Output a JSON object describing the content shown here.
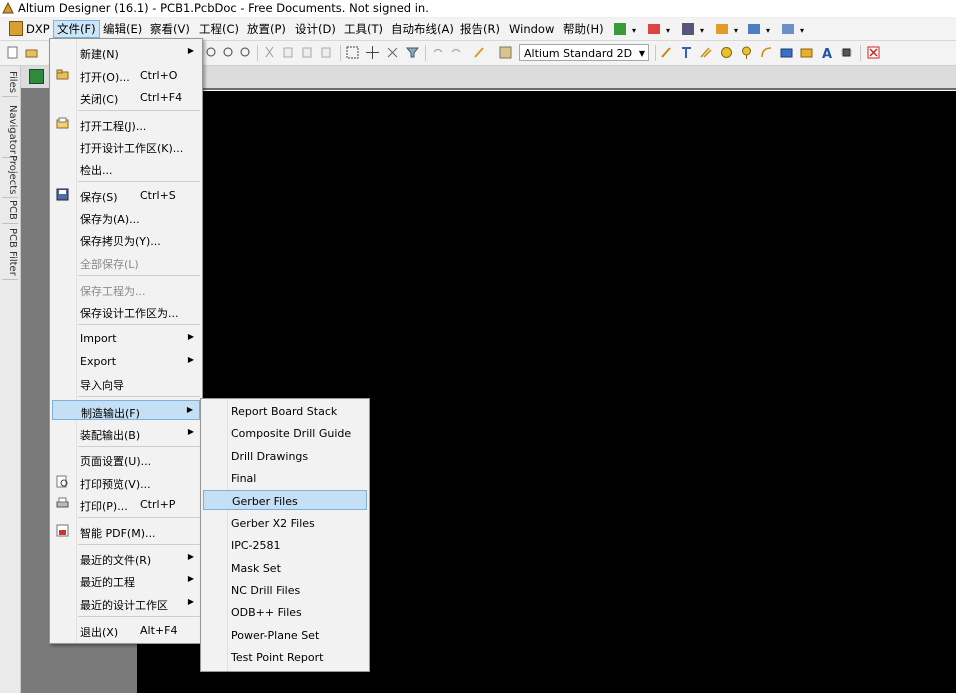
{
  "window": {
    "title": "Altium Designer (16.1) - PCB1.PcbDoc - Free Documents. Not signed in."
  },
  "menubar": {
    "items": [
      "DXP",
      "文件(F)",
      "编辑(E)",
      "察看(V)",
      "工程(C)",
      "放置(P)",
      "设计(D)",
      "工具(T)",
      "自动布线(A)",
      "报告(R)",
      "Window",
      "帮助(H)"
    ]
  },
  "toolbar": {
    "view_combo": "Altium Standard 2D"
  },
  "left_panel_tabs": [
    "Files",
    "Navigator",
    "Projects",
    "PCB",
    "PCB Filter"
  ],
  "file_menu": {
    "items": [
      {
        "label": "新建(N)",
        "shortcut": "",
        "submenu": true
      },
      {
        "label": "打开(O)...",
        "shortcut": "Ctrl+O",
        "icon": "open-folder-icon"
      },
      {
        "label": "关闭(C)",
        "shortcut": "Ctrl+F4"
      },
      {
        "label": "打开工程(J)...",
        "icon": "open-project-icon"
      },
      {
        "label": "打开设计工作区(K)..."
      },
      {
        "label": "检出..."
      },
      {
        "label": "保存(S)",
        "shortcut": "Ctrl+S",
        "icon": "save-icon"
      },
      {
        "label": "保存为(A)..."
      },
      {
        "label": "保存拷贝为(Y)..."
      },
      {
        "label": "全部保存(L)",
        "disabled": true
      },
      {
        "label": "保存工程为...",
        "disabled": true
      },
      {
        "label": "保存设计工作区为..."
      },
      {
        "label": "Import",
        "submenu": true
      },
      {
        "label": "Export",
        "submenu": true
      },
      {
        "label": "导入向导"
      },
      {
        "label": "制造输出(F)",
        "submenu": true,
        "highlighted": true
      },
      {
        "label": "装配输出(B)",
        "submenu": true
      },
      {
        "label": "页面设置(U)..."
      },
      {
        "label": "打印预览(V)...",
        "icon": "print-preview-icon"
      },
      {
        "label": "打印(P)...",
        "shortcut": "Ctrl+P",
        "icon": "printer-icon"
      },
      {
        "label": "智能 PDF(M)...",
        "icon": "pdf-icon"
      },
      {
        "label": "最近的文件(R)",
        "submenu": true
      },
      {
        "label": "最近的工程",
        "submenu": true
      },
      {
        "label": "最近的设计工作区",
        "submenu": true
      },
      {
        "label": "退出(X)",
        "shortcut": "Alt+F4"
      }
    ]
  },
  "fab_submenu": {
    "items": [
      "Report Board Stack",
      "Composite Drill Guide",
      "Drill Drawings",
      "Final",
      "Gerber Files",
      "Gerber X2 Files",
      "IPC-2581",
      "Mask Set",
      "NC Drill Files",
      "ODB++ Files",
      "Power-Plane Set",
      "Test Point Report"
    ],
    "highlighted_index": 4
  }
}
